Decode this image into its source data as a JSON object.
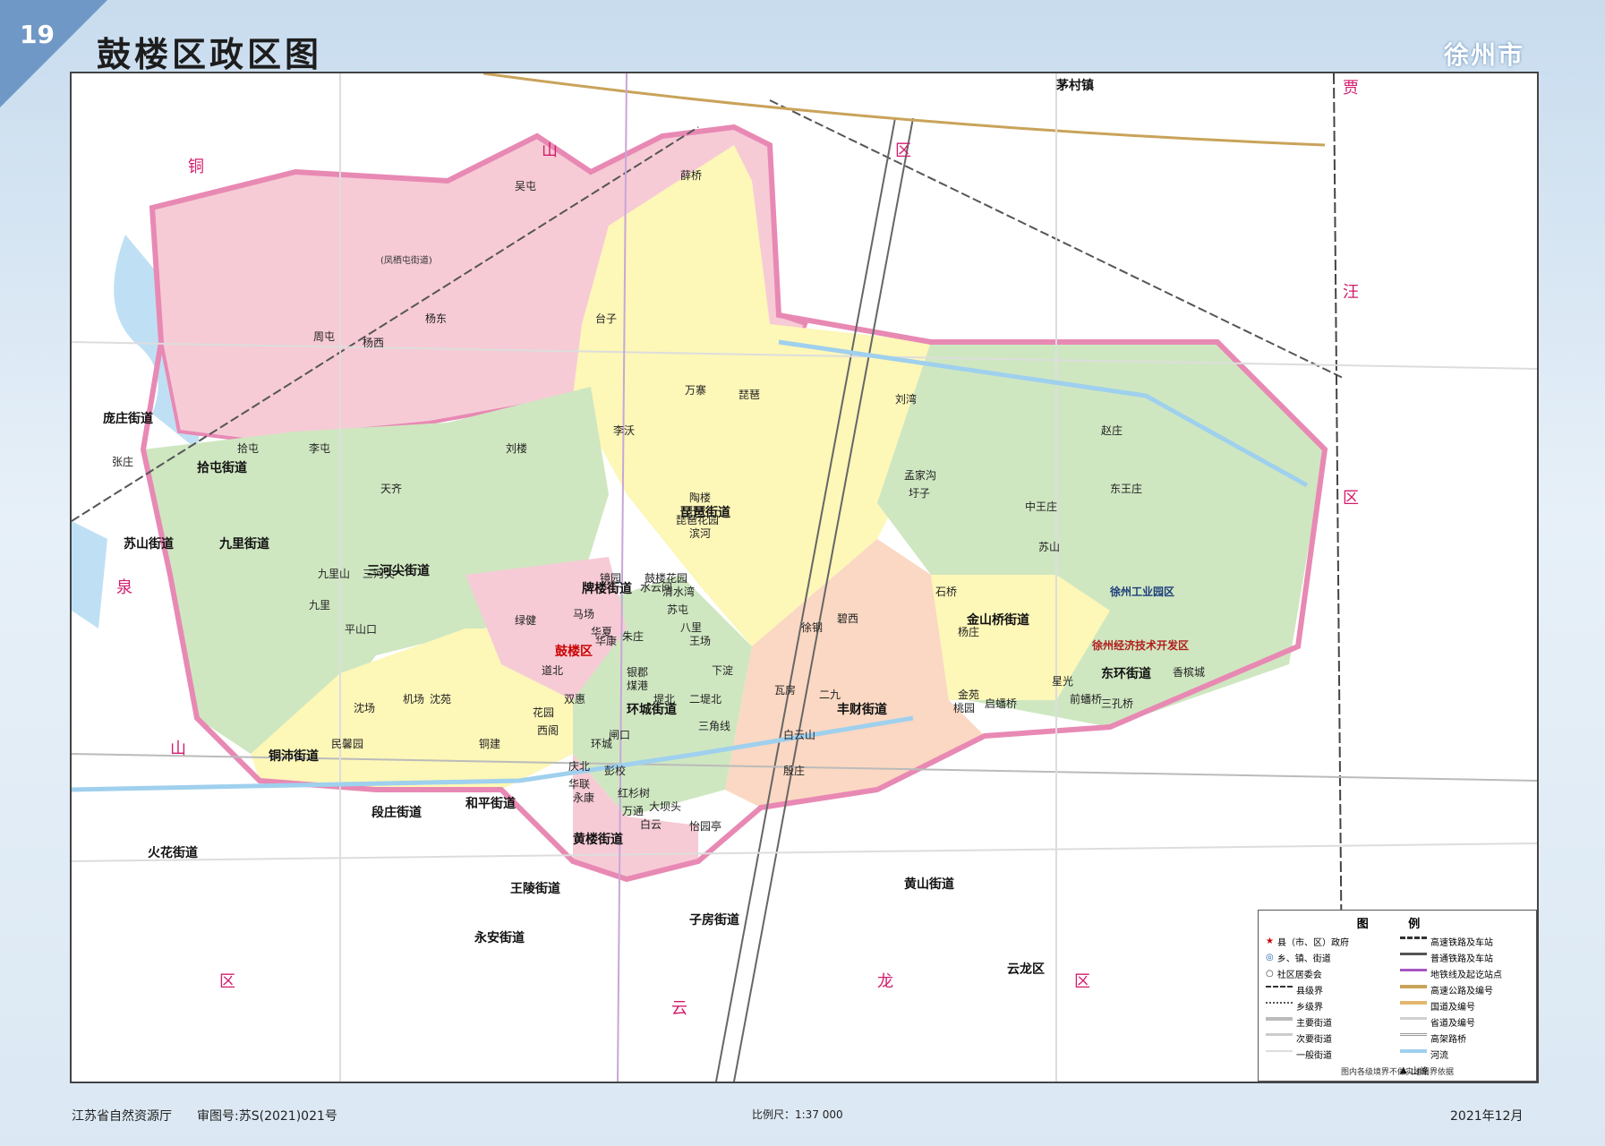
{
  "page_number": "19",
  "title": "鼓楼区政区图",
  "city": "徐州市",
  "footer": {
    "publisher": "江苏省自然资源厅",
    "review": "审图号:苏S(2021)021号",
    "scale": "比例尺：1:37 000",
    "date": "2021年12月"
  },
  "outer_regions": {
    "tongshan": [
      "铜",
      "山",
      "区"
    ],
    "jiawang": [
      "贾",
      "汪",
      "区"
    ],
    "quanshan": [
      "泉",
      "山",
      "区"
    ],
    "yunlong": [
      "云",
      "龙",
      "区"
    ]
  },
  "subdistricts": {
    "huangshan": "黄山街道",
    "pailou": "牌楼街道",
    "pipa": "琵琶街道",
    "huancheng": "环城街道",
    "fengcai": "丰财街道",
    "jinshanqiao": "金山桥街道",
    "dongzhuan": "东环街道",
    "huanglou": "黄楼街道",
    "sanhejian": "三河尖街道",
    "jiuli": "九里街道",
    "shitun": "拾屯街道",
    "sushan": "苏山街道",
    "tongpei": "铜沛街道",
    "pangzhuang": "庞庄街道",
    "duanzhuang": "段庄街道",
    "heping": "和平街道",
    "huohua": "火花街道",
    "wangling": "王陵街道",
    "yongan": "永安街道",
    "zifang": "子房街道",
    "huangshanyun": "黄山街道"
  },
  "places": {
    "gulou": "鼓楼区",
    "yunlong": "云龙区",
    "maocun": "茅村镇",
    "kaifa": "徐州经济技术开发区",
    "gongye": "徐州工业园区",
    "fenghuang": "(凤栖屯街道)"
  },
  "villages": [
    "吴屯",
    "薛桥",
    "杨东",
    "周屯",
    "杨西",
    "台子",
    "万寨",
    "琵琶",
    "刘湾",
    "赵庄",
    "孟家沟",
    "圩子",
    "中王庄",
    "东王庄",
    "李沃",
    "刘楼",
    "拾屯",
    "李屯",
    "张庄",
    "天齐",
    "九里",
    "九里山",
    "三河尖",
    "平山口",
    "沈场",
    "机场",
    "沈苑",
    "民馨园",
    "铜建",
    "道北",
    "绿健",
    "马场",
    "华夏",
    "华康",
    "镜园",
    "鼓楼花园",
    "水云间",
    "清水湾",
    "八里",
    "苏屯",
    "朱庄",
    "王场",
    "银郡",
    "煤港",
    "双惠",
    "堤北",
    "二堤北",
    "三角线",
    "花园",
    "西阁",
    "闸口",
    "环城",
    "庆北",
    "华联",
    "彭校",
    "永康",
    "红杉树",
    "万通",
    "大坝头",
    "白云",
    "怡园亭",
    "下淀",
    "瓦房",
    "二九",
    "徐钢",
    "碧西",
    "石桥",
    "杨庄",
    "金苑",
    "桃园",
    "启蟠桥",
    "星光",
    "前蟠桥",
    "三孔桥",
    "香槟城",
    "白云山",
    "殷庄",
    "滨河",
    "琵琶花园",
    "陶楼",
    "苏山"
  ],
  "legend": {
    "title": "图 例",
    "items": [
      "县（市、区）政府",
      "乡、镇、街道",
      "社区居委会",
      "县级界",
      "乡级界",
      "主要街道",
      "次要街道",
      "一般街道",
      "高速铁路及车站",
      "普通铁路及车站",
      "地铁线及起讫站点",
      "高速公路及编号",
      "国道及编号",
      "省道及编号",
      "高架路桥",
      "河流",
      "山峰"
    ],
    "note": "图内各级境界不做实地划界依据"
  }
}
